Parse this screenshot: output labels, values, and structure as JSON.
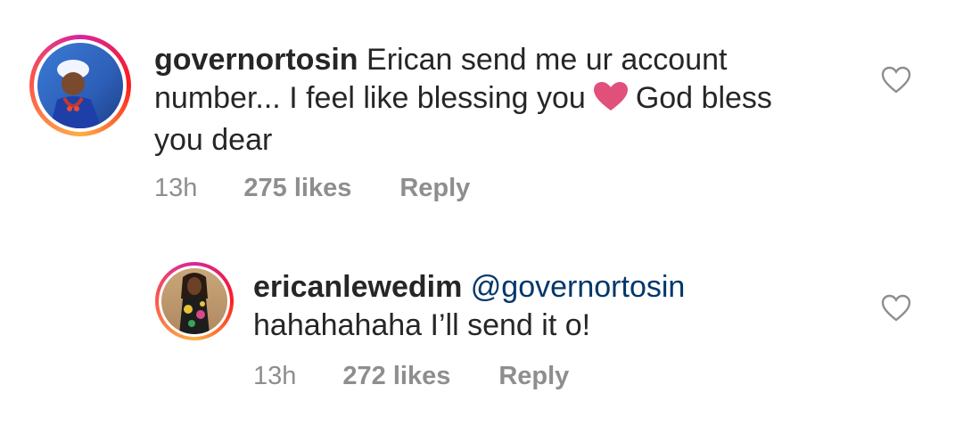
{
  "comments": [
    {
      "username": "governortosin",
      "text_part1": "Erican send me ur account",
      "text_line2_a": "number... I feel like blessing you",
      "text_line2_b": "God bless",
      "text_line3": "you dear",
      "inline_icon": "heart-emoji",
      "time": "13h",
      "likes": "275 likes",
      "reply": "Reply",
      "like_icon": "heart-outline-icon"
    },
    {
      "username": "ericanlewedim",
      "mention": "@governortosin",
      "text_line2": "hahahahaha I’ll send it o!",
      "time": "13h",
      "likes": "272 likes",
      "reply": "Reply",
      "like_icon": "heart-outline-icon"
    }
  ],
  "colors": {
    "text": "#262626",
    "meta": "#8e8e8e",
    "mention": "#00376b",
    "heart": "#e0507a"
  }
}
